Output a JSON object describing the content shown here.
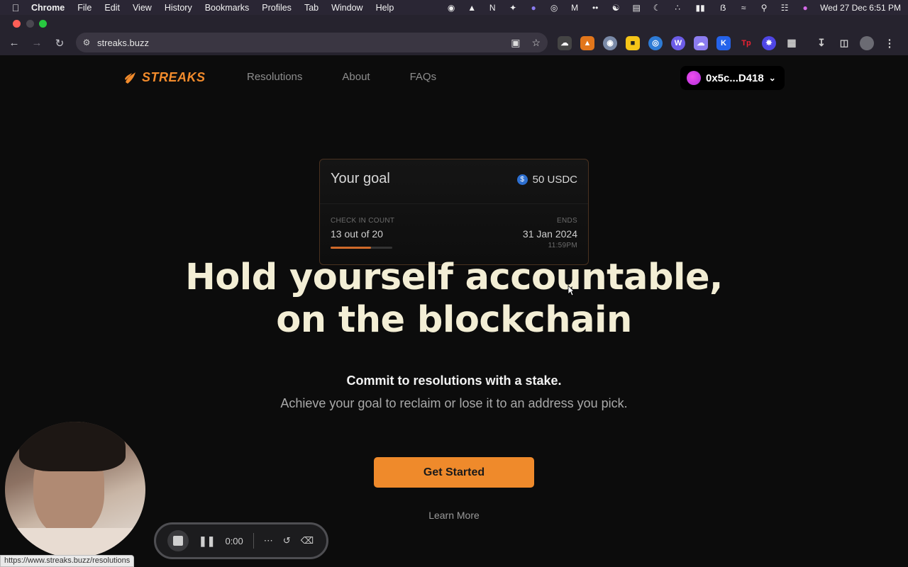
{
  "menubar": {
    "app": "Chrome",
    "items": [
      "File",
      "Edit",
      "View",
      "History",
      "Bookmarks",
      "Profiles",
      "Tab",
      "Window",
      "Help"
    ],
    "datetime": "Wed 27 Dec  6:51 PM"
  },
  "browser": {
    "url": "streaks.buzz",
    "status_url": "https://www.streaks.buzz/resolutions"
  },
  "site": {
    "logo": "STREAKS",
    "nav": [
      "Resolutions",
      "About",
      "FAQs"
    ],
    "wallet": "0x5c...D418"
  },
  "goal_card": {
    "title": "Your goal",
    "stake": "50 USDC",
    "checkin_label": "CHECK IN COUNT",
    "checkin_value": "13 out of 20",
    "checkin_progress": 0.65,
    "ends_label": "ENDS",
    "ends_date": "31 Jan 2024",
    "ends_time": "11:59PM"
  },
  "hero": {
    "line1": "Hold yourself accountable,",
    "line2": "on the blockchain"
  },
  "subtitle": {
    "line1": "Commit to resolutions with a stake.",
    "line2": "Achieve your goal to reclaim or lose it to an address you pick."
  },
  "cta": {
    "primary": "Get Started",
    "secondary": "Learn More"
  },
  "recorder": {
    "timer": "0:00"
  },
  "colors": {
    "accent": "#ef8a2b",
    "hero_text": "#f3eed5",
    "background": "#0c0c0c"
  }
}
